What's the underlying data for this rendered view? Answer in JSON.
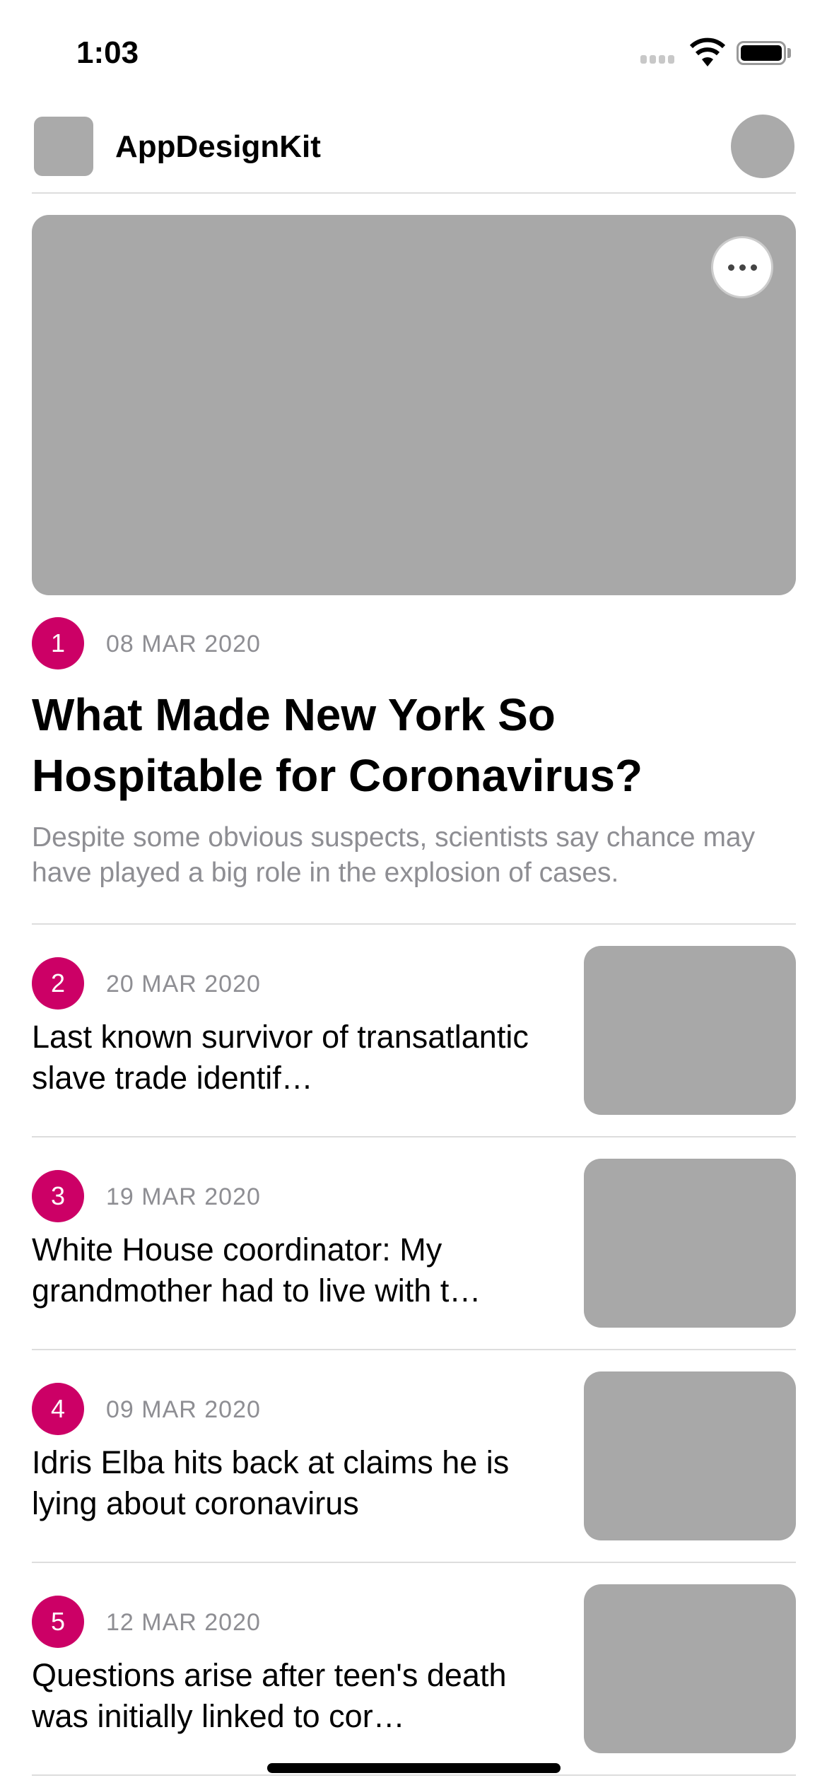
{
  "status_bar": {
    "time": "1:03"
  },
  "header": {
    "title": "AppDesignKit"
  },
  "featured": {
    "rank": "1",
    "date": "08 MAR 2020",
    "title": "What Made New York So Hospitable for Coronavirus?",
    "subtitle": "Despite some obvious suspects, scientists say chance may have played a big role in the explosion of cases."
  },
  "articles": [
    {
      "rank": "2",
      "date": "20 MAR 2020",
      "title": "Last known survivor of transatlantic slave trade identif…"
    },
    {
      "rank": "3",
      "date": "19 MAR 2020",
      "title": "White House coordinator: My grandmother had to live with t…"
    },
    {
      "rank": "4",
      "date": "09 MAR 2020",
      "title": "Idris Elba hits back at claims he is lying about coronavirus"
    },
    {
      "rank": "5",
      "date": "12 MAR 2020",
      "title": "Questions arise after teen's death was initially linked to cor…"
    }
  ],
  "colors": {
    "accent": "#cc0066",
    "placeholder": "#a8a8a8"
  }
}
